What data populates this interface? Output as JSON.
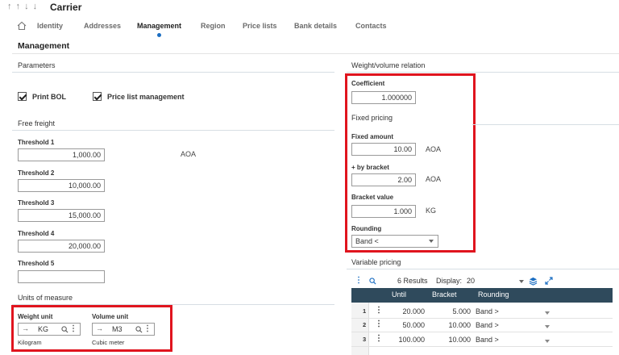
{
  "header": {
    "arrows": "↑ ↑ ↓ ↓",
    "title": "Carrier"
  },
  "tabs": [
    {
      "label": "Identity"
    },
    {
      "label": "Addresses"
    },
    {
      "label": "Management"
    },
    {
      "label": "Region"
    },
    {
      "label": "Price lists"
    },
    {
      "label": "Bank details"
    },
    {
      "label": "Contacts"
    }
  ],
  "active_tab": "Management",
  "section_title": "Management",
  "parameters": {
    "title": "Parameters",
    "print_bol": {
      "label": "Print BOL",
      "checked": true
    },
    "price_list_management": {
      "label": "Price list management",
      "checked": true
    }
  },
  "free_freight": {
    "title": "Free freight",
    "currency": "AOA",
    "thresholds": [
      {
        "label": "Threshold 1",
        "value": "1,000.00"
      },
      {
        "label": "Threshold 2",
        "value": "10,000.00"
      },
      {
        "label": "Threshold 3",
        "value": "15,000.00"
      },
      {
        "label": "Threshold 4",
        "value": "20,000.00"
      },
      {
        "label": "Threshold 5",
        "value": ""
      }
    ]
  },
  "units": {
    "title": "Units of measure",
    "weight": {
      "label": "Weight unit",
      "value": "KG",
      "desc": "Kilogram"
    },
    "volume": {
      "label": "Volume unit",
      "value": "M3",
      "desc": "Cubic meter"
    }
  },
  "weight_volume": {
    "title": "Weight/volume relation",
    "coefficient_label": "Coefficient",
    "coefficient": "1.000000"
  },
  "fixed_pricing": {
    "title": "Fixed pricing",
    "fixed_amount_label": "Fixed amount",
    "fixed_amount": "10.00",
    "fixed_amount_unit": "AOA",
    "by_bracket_label": "+ by bracket",
    "by_bracket": "2.00",
    "by_bracket_unit": "AOA",
    "bracket_value_label": "Bracket value",
    "bracket_value": "1.000",
    "bracket_value_unit": "KG",
    "rounding_label": "Rounding",
    "rounding": "Band <"
  },
  "variable_pricing": {
    "title": "Variable pricing",
    "results": "6 Results",
    "display_label": "Display:",
    "display_value": "20",
    "columns": [
      "Until",
      "Bracket",
      "Rounding"
    ],
    "rows": [
      {
        "n": "1",
        "until": "20.000",
        "bracket": "5.000",
        "rounding": "Band >"
      },
      {
        "n": "2",
        "until": "50.000",
        "bracket": "10.000",
        "rounding": "Band >"
      },
      {
        "n": "3",
        "until": "100.000",
        "bracket": "10.000",
        "rounding": "Band >"
      }
    ]
  },
  "colors": {
    "highlight": "#e0141e",
    "grid_header": "#2f4a5c",
    "accent": "#1b6ec2"
  }
}
